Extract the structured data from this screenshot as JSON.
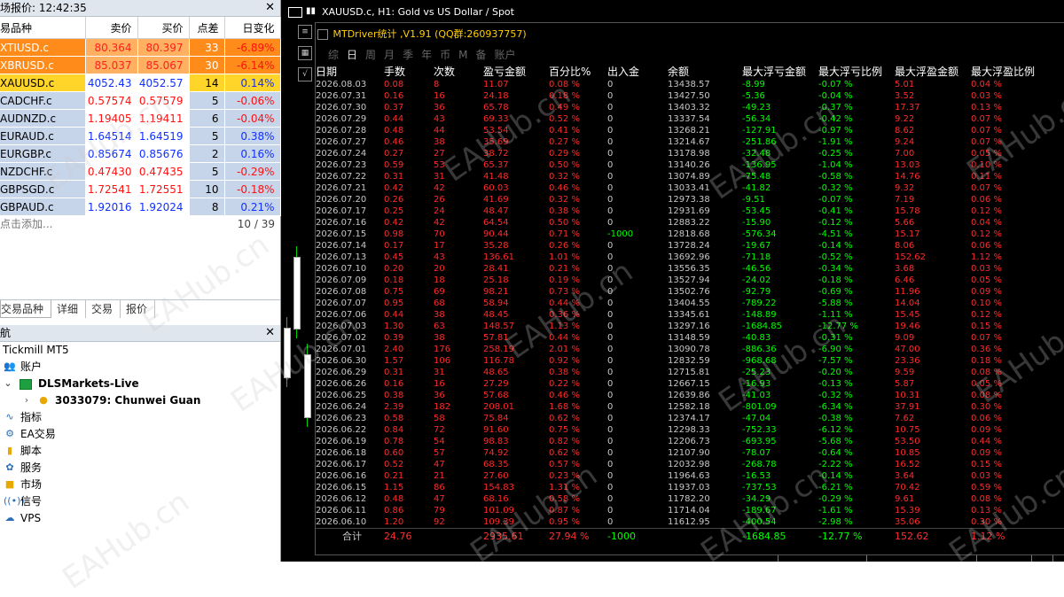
{
  "market_watch": {
    "title": "场报价: 12:42:35",
    "close": "✕",
    "columns": [
      "易品种",
      "卖价",
      "买价",
      "点差",
      "日变化"
    ],
    "rows": [
      {
        "symbol": "XTIUSD.c",
        "bid": "80.364",
        "ask": "80.397",
        "spread": "33",
        "change": "-6.89%",
        "style": "orange",
        "dir": "down"
      },
      {
        "symbol": "XBRUSD.c",
        "bid": "85.037",
        "ask": "85.067",
        "spread": "30",
        "change": "-6.14%",
        "style": "orange",
        "dir": "down"
      },
      {
        "symbol": "XAUUSD.c",
        "bid": "4052.43",
        "ask": "4052.57",
        "spread": "14",
        "change": "0.14%",
        "style": "yellow",
        "dir": "up"
      },
      {
        "symbol": "CADCHF.c",
        "bid": "0.57574",
        "ask": "0.57579",
        "spread": "5",
        "change": "-0.06%",
        "style": "blue",
        "dir": "down"
      },
      {
        "symbol": "AUDNZD.c",
        "bid": "1.19405",
        "ask": "1.19411",
        "spread": "6",
        "change": "-0.04%",
        "style": "blue",
        "dir": "down"
      },
      {
        "symbol": "EURAUD.c",
        "bid": "1.64514",
        "ask": "1.64519",
        "spread": "5",
        "change": "0.38%",
        "style": "blue",
        "dir": "up"
      },
      {
        "symbol": "EURGBP.c",
        "bid": "0.85674",
        "ask": "0.85676",
        "spread": "2",
        "change": "0.16%",
        "style": "blue",
        "dir": "up"
      },
      {
        "symbol": "NZDCHF.c",
        "bid": "0.47430",
        "ask": "0.47435",
        "spread": "5",
        "change": "-0.29%",
        "style": "blue",
        "dir": "down"
      },
      {
        "symbol": "GBPSGD.c",
        "bid": "1.72541",
        "ask": "1.72551",
        "spread": "10",
        "change": "-0.18%",
        "style": "blue",
        "dir": "down"
      },
      {
        "symbol": "GBPAUD.c",
        "bid": "1.92016",
        "ask": "1.92024",
        "spread": "8",
        "change": "0.21%",
        "style": "blue",
        "dir": "up"
      }
    ],
    "add_label": "点击添加...",
    "count": "10 / 39",
    "tabs": [
      "交易品种",
      "详细",
      "交易",
      "报价"
    ]
  },
  "navigator": {
    "title": "航",
    "close": "✕",
    "broker": "Tickmill MT5",
    "accounts_label": "账户",
    "server": "DLSMarkets-Live",
    "account": "3033079: Chunwei Guan",
    "items": [
      "指标",
      "EA交易",
      "脚本",
      "服务",
      "市场",
      "信号",
      "VPS"
    ]
  },
  "chart": {
    "title": "XAUUSD.c, H1:  Gold vs US Dollar / Spot"
  },
  "stats": {
    "title": "MTDriver统计 ,V1.91 (QQ群:260937757)",
    "periods": [
      "综",
      "日",
      "周",
      "月",
      "季",
      "年",
      "币",
      "M",
      "备",
      "账户"
    ],
    "active_period": "日",
    "headers": [
      "日期",
      "手数",
      "次数",
      "盈亏金额",
      "百分比%",
      "出入金",
      "余额",
      "最大浮亏金额",
      "最大浮亏比例",
      "最大浮盈金额",
      "最大浮盈比例"
    ],
    "rows": [
      [
        "2026.08.03",
        "0.08",
        "8",
        "11.07",
        "0.08 %",
        "0",
        "13438.57",
        "-8.99",
        "-0.07 %",
        "5.01",
        "0.04 %"
      ],
      [
        "2026.07.31",
        "0.16",
        "16",
        "24.18",
        "0.18 %",
        "0",
        "13427.50",
        "-5.36",
        "-0.04 %",
        "3.52",
        "0.03 %"
      ],
      [
        "2026.07.30",
        "0.37",
        "36",
        "65.78",
        "0.49 %",
        "0",
        "13403.32",
        "-49.23",
        "-0.37 %",
        "17.37",
        "0.13 %"
      ],
      [
        "2026.07.29",
        "0.44",
        "43",
        "69.33",
        "0.52 %",
        "0",
        "13337.54",
        "-56.34",
        "-0.42 %",
        "9.22",
        "0.07 %"
      ],
      [
        "2026.07.28",
        "0.48",
        "44",
        "53.54",
        "0.41 %",
        "0",
        "13268.21",
        "-127.91",
        "-0.97 %",
        "8.62",
        "0.07 %"
      ],
      [
        "2026.07.27",
        "0.46",
        "38",
        "35.69",
        "0.27 %",
        "0",
        "13214.67",
        "-251.86",
        "-1.91 %",
        "9.24",
        "0.07 %"
      ],
      [
        "2026.07.24",
        "0.27",
        "27",
        "38.72",
        "0.29 %",
        "0",
        "13178.98",
        "-32.48",
        "-0.25 %",
        "7.00",
        "0.05 %"
      ],
      [
        "2026.07.23",
        "0.59",
        "53",
        "65.37",
        "0.50 %",
        "0",
        "13140.26",
        "-136.95",
        "-1.04 %",
        "13.03",
        "0.10 %"
      ],
      [
        "2026.07.22",
        "0.31",
        "31",
        "41.48",
        "0.32 %",
        "0",
        "13074.89",
        "-75.48",
        "-0.58 %",
        "14.76",
        "0.11 %"
      ],
      [
        "2026.07.21",
        "0.42",
        "42",
        "60.03",
        "0.46 %",
        "0",
        "13033.41",
        "-41.82",
        "-0.32 %",
        "9.32",
        "0.07 %"
      ],
      [
        "2026.07.20",
        "0.26",
        "26",
        "41.69",
        "0.32 %",
        "0",
        "12973.38",
        "-9.51",
        "-0.07 %",
        "7.19",
        "0.06 %"
      ],
      [
        "2026.07.17",
        "0.25",
        "24",
        "48.47",
        "0.38 %",
        "0",
        "12931.69",
        "-53.45",
        "-0.41 %",
        "15.78",
        "0.12 %"
      ],
      [
        "2026.07.16",
        "0.42",
        "42",
        "64.54",
        "0.50 %",
        "0",
        "12883.22",
        "-15.90",
        "-0.12 %",
        "5.66",
        "0.04 %"
      ],
      [
        "2026.07.15",
        "0.98",
        "70",
        "90.44",
        "0.71 %",
        "-1000",
        "12818.68",
        "-576.34",
        "-4.51 %",
        "15.17",
        "0.12 %"
      ],
      [
        "2026.07.14",
        "0.17",
        "17",
        "35.28",
        "0.26 %",
        "0",
        "13728.24",
        "-19.67",
        "-0.14 %",
        "8.06",
        "0.06 %"
      ],
      [
        "2026.07.13",
        "0.45",
        "43",
        "136.61",
        "1.01 %",
        "0",
        "13692.96",
        "-71.18",
        "-0.52 %",
        "152.62",
        "1.12 %"
      ],
      [
        "2026.07.10",
        "0.20",
        "20",
        "28.41",
        "0.21 %",
        "0",
        "13556.35",
        "-46.56",
        "-0.34 %",
        "3.68",
        "0.03 %"
      ],
      [
        "2026.07.09",
        "0.18",
        "18",
        "25.18",
        "0.19 %",
        "0",
        "13527.94",
        "-24.02",
        "-0.18 %",
        "6.46",
        "0.05 %"
      ],
      [
        "2026.07.08",
        "0.75",
        "69",
        "98.21",
        "0.73 %",
        "0",
        "13502.76",
        "-92.79",
        "-0.69 %",
        "11.96",
        "0.09 %"
      ],
      [
        "2026.07.07",
        "0.95",
        "68",
        "58.94",
        "0.44 %",
        "0",
        "13404.55",
        "-789.22",
        "-5.88 %",
        "14.04",
        "0.10 %"
      ],
      [
        "2026.07.06",
        "0.44",
        "38",
        "48.45",
        "0.36 %",
        "0",
        "13345.61",
        "-148.89",
        "-1.11 %",
        "15.45",
        "0.12 %"
      ],
      [
        "2026.07.03",
        "1.30",
        "63",
        "148.57",
        "1.13 %",
        "0",
        "13297.16",
        "-1684.85",
        "-12.77 %",
        "19.46",
        "0.15 %"
      ],
      [
        "2026.07.02",
        "0.39",
        "38",
        "57.81",
        "0.44 %",
        "0",
        "13148.59",
        "-40.83",
        "-0.31 %",
        "9.09",
        "0.07 %"
      ],
      [
        "2026.07.01",
        "2.40",
        "176",
        "258.19",
        "2.01 %",
        "0",
        "13090.78",
        "-886.36",
        "-6.90 %",
        "47.00",
        "0.36 %"
      ],
      [
        "2026.06.30",
        "1.57",
        "106",
        "116.78",
        "0.92 %",
        "0",
        "12832.59",
        "-968.68",
        "-7.57 %",
        "23.36",
        "0.18 %"
      ],
      [
        "2026.06.29",
        "0.31",
        "31",
        "48.65",
        "0.38 %",
        "0",
        "12715.81",
        "-25.23",
        "-0.20 %",
        "9.59",
        "0.08 %"
      ],
      [
        "2026.06.26",
        "0.16",
        "16",
        "27.29",
        "0.22 %",
        "0",
        "12667.15",
        "-16.93",
        "-0.13 %",
        "5.87",
        "0.05 %"
      ],
      [
        "2026.06.25",
        "0.38",
        "36",
        "57.68",
        "0.46 %",
        "0",
        "12639.86",
        "-41.03",
        "-0.32 %",
        "10.31",
        "0.08 %"
      ],
      [
        "2026.06.24",
        "2.39",
        "182",
        "208.01",
        "1.68 %",
        "0",
        "12582.18",
        "-801.09",
        "-6.34 %",
        "37.91",
        "0.30 %"
      ],
      [
        "2026.06.23",
        "0.58",
        "58",
        "75.84",
        "0.62 %",
        "0",
        "12374.17",
        "-47.04",
        "-0.38 %",
        "7.62",
        "0.06 %"
      ],
      [
        "2026.06.22",
        "0.84",
        "72",
        "91.60",
        "0.75 %",
        "0",
        "12298.33",
        "-752.33",
        "-6.12 %",
        "10.75",
        "0.09 %"
      ],
      [
        "2026.06.19",
        "0.78",
        "54",
        "98.83",
        "0.82 %",
        "0",
        "12206.73",
        "-693.95",
        "-5.68 %",
        "53.50",
        "0.44 %"
      ],
      [
        "2026.06.18",
        "0.60",
        "57",
        "74.92",
        "0.62 %",
        "0",
        "12107.90",
        "-78.07",
        "-0.64 %",
        "10.85",
        "0.09 %"
      ],
      [
        "2026.06.17",
        "0.52",
        "47",
        "68.35",
        "0.57 %",
        "0",
        "12032.98",
        "-268.78",
        "-2.22 %",
        "16.52",
        "0.15 %"
      ],
      [
        "2026.06.16",
        "0.21",
        "21",
        "27.60",
        "0.23 %",
        "0",
        "11964.63",
        "-16.53",
        "-0.14 %",
        "3.64",
        "0.03 %"
      ],
      [
        "2026.06.15",
        "1.15",
        "86",
        "154.83",
        "1.31 %",
        "0",
        "11937.03",
        "-737.53",
        "-6.21 %",
        "70.42",
        "0.59 %"
      ],
      [
        "2026.06.12",
        "0.48",
        "47",
        "68.16",
        "0.58 %",
        "0",
        "11782.20",
        "-34.29",
        "-0.29 %",
        "9.61",
        "0.08 %"
      ],
      [
        "2026.06.11",
        "0.86",
        "79",
        "101.09",
        "0.87 %",
        "0",
        "11714.04",
        "-189.67",
        "-1.61 %",
        "15.39",
        "0.13 %"
      ],
      [
        "2026.06.10",
        "1.20",
        "92",
        "109.39",
        "0.95 %",
        "0",
        "11612.95",
        "-400.54",
        "-2.98 %",
        "35.06",
        "0.30 %"
      ]
    ],
    "total": [
      "合计",
      "24.76",
      "",
      "2935.61",
      "27.94 %",
      "-1000",
      "",
      "-1684.85",
      "-12.77 %",
      "152.62",
      "1.12 %"
    ]
  },
  "watermark": "EAHub.cn",
  "colors": {
    "orange": "#ff8c1a",
    "yellow": "#ffd52a",
    "blue": "#c7d5ea",
    "loss": "#ff2a2a",
    "profit": "#00ff00"
  }
}
